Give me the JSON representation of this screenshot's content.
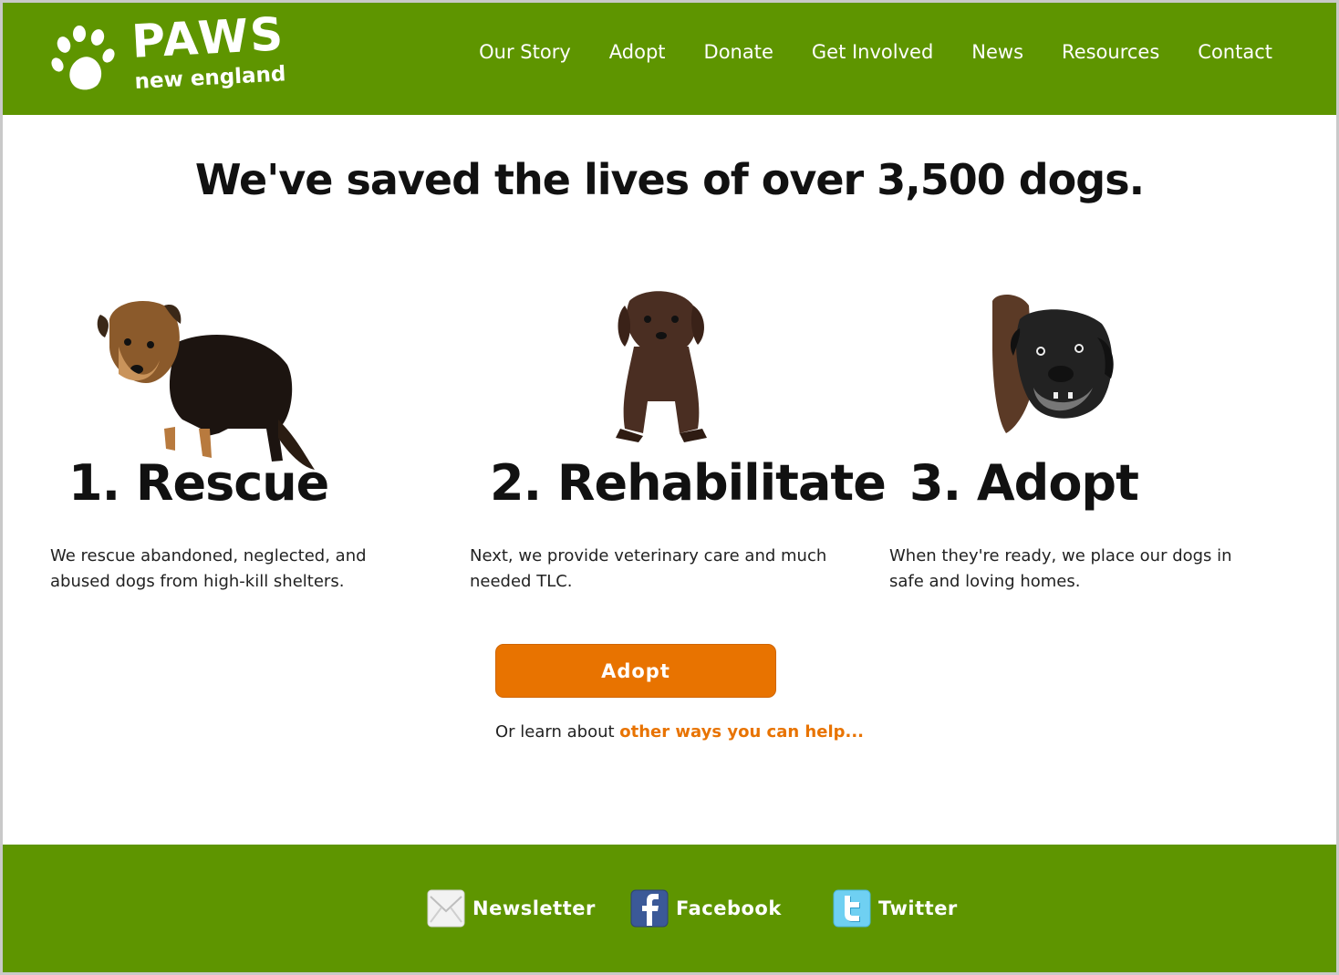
{
  "logo": {
    "title": "PAWS",
    "subtitle": "new england"
  },
  "nav": {
    "items": [
      "Our Story",
      "Adopt",
      "Donate",
      "Get Involved",
      "News",
      "Resources",
      "Contact"
    ]
  },
  "headline": "We've saved the lives of over 3,500 dogs.",
  "steps": [
    {
      "title": "1. Rescue",
      "description": "We rescue abandoned, neglected, and abused dogs from high-kill shelters."
    },
    {
      "title": "2. Rehabilitate",
      "description": "Next, we provide veterinary care and much needed TLC."
    },
    {
      "title": "3. Adopt",
      "description": "When they're ready, we place our dogs in safe and loving homes."
    }
  ],
  "cta": {
    "button_label": "Adopt",
    "help_prefix": "Or learn about ",
    "help_link": "other ways you can help..."
  },
  "footer": {
    "links": [
      "Newsletter",
      "Facebook",
      "Twitter"
    ]
  },
  "colors": {
    "brand_green": "#5e9500",
    "accent_orange": "#e87300"
  },
  "icons": {
    "logo": "paw-print-icon",
    "newsletter": "envelope-icon",
    "facebook": "facebook-icon",
    "twitter": "twitter-icon"
  }
}
